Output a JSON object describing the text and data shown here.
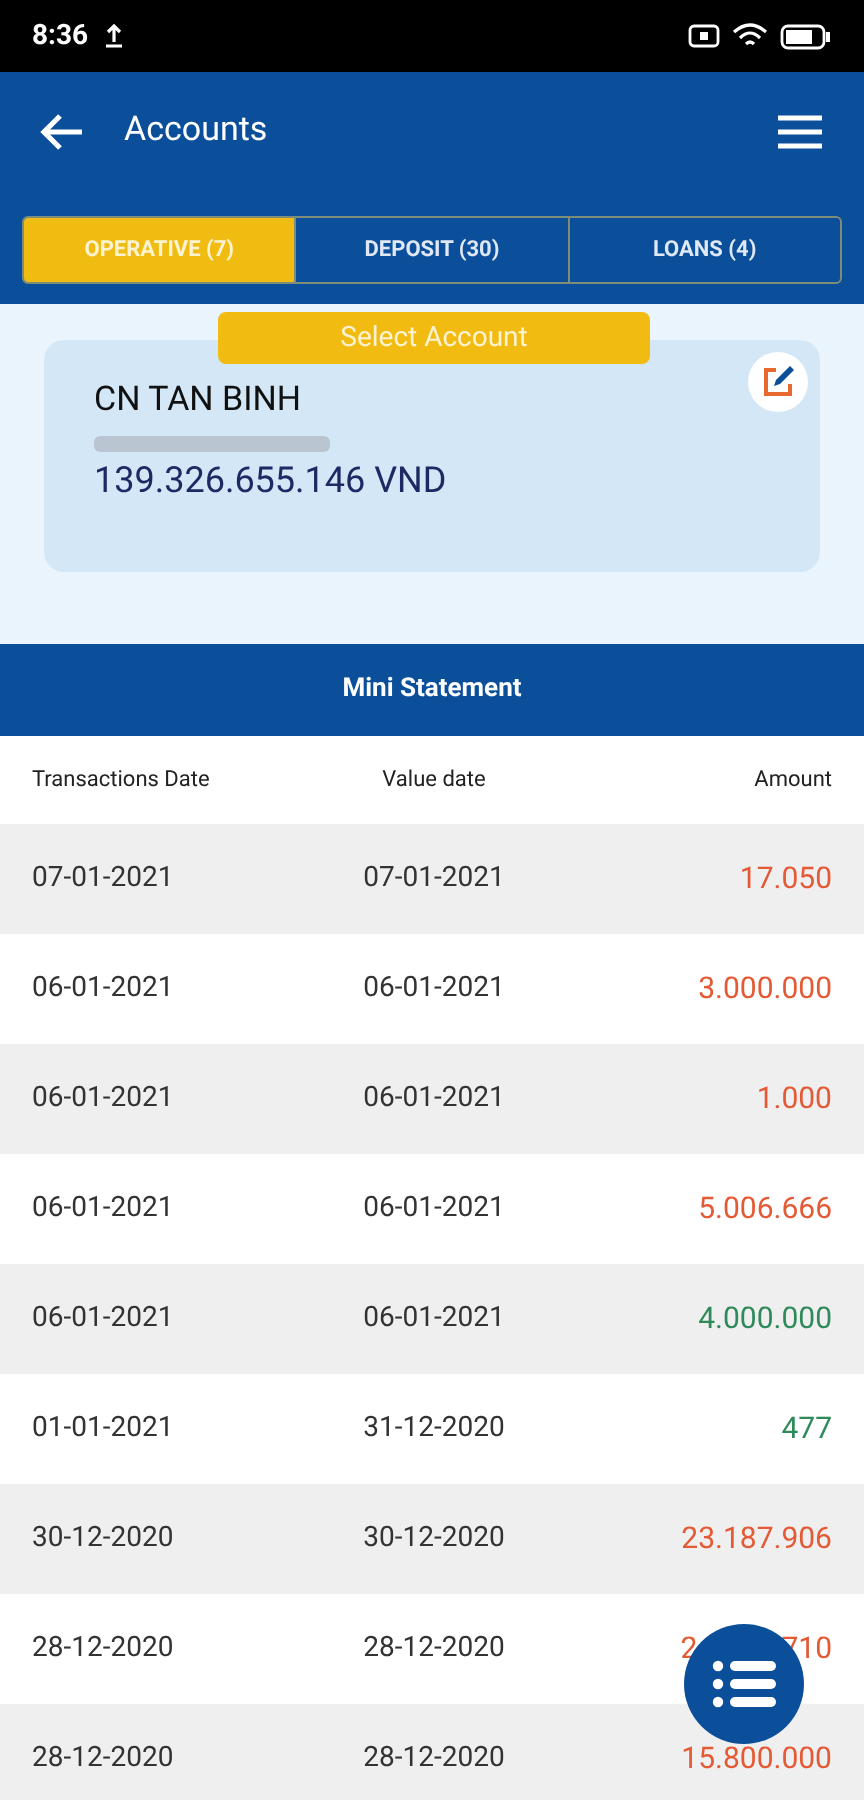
{
  "status_bar": {
    "time": "8:36"
  },
  "app_bar": {
    "title": "Accounts"
  },
  "tabs": [
    {
      "label": "OPERATIVE (7)",
      "selected": true
    },
    {
      "label": "DEPOSIT (30)",
      "selected": false
    },
    {
      "label": "LOANS (4)",
      "selected": false
    }
  ],
  "account_card": {
    "select_label": "Select Account",
    "name": "CN TAN BINH",
    "balance": "139.326.655.146 VND"
  },
  "mini_statement": {
    "title": "Mini Statement",
    "columns": [
      "Transactions Date",
      "Value date",
      "Amount"
    ],
    "rows": [
      {
        "transaction_date": "07-01-2021",
        "value_date": "07-01-2021",
        "amount": "17.050",
        "kind": "debit"
      },
      {
        "transaction_date": "06-01-2021",
        "value_date": "06-01-2021",
        "amount": "3.000.000",
        "kind": "debit"
      },
      {
        "transaction_date": "06-01-2021",
        "value_date": "06-01-2021",
        "amount": "1.000",
        "kind": "debit"
      },
      {
        "transaction_date": "06-01-2021",
        "value_date": "06-01-2021",
        "amount": "5.006.666",
        "kind": "debit"
      },
      {
        "transaction_date": "06-01-2021",
        "value_date": "06-01-2021",
        "amount": "4.000.000",
        "kind": "credit"
      },
      {
        "transaction_date": "01-01-2021",
        "value_date": "31-12-2020",
        "amount": "477",
        "kind": "credit"
      },
      {
        "transaction_date": "30-12-2020",
        "value_date": "30-12-2020",
        "amount": "23.187.906",
        "kind": "debit"
      },
      {
        "transaction_date": "28-12-2020",
        "value_date": "28-12-2020",
        "amount": "2",
        "amount_end": "710",
        "kind": "debit"
      },
      {
        "transaction_date": "28-12-2020",
        "value_date": "28-12-2020",
        "amount": "15.800.000",
        "kind": "debit"
      }
    ]
  }
}
